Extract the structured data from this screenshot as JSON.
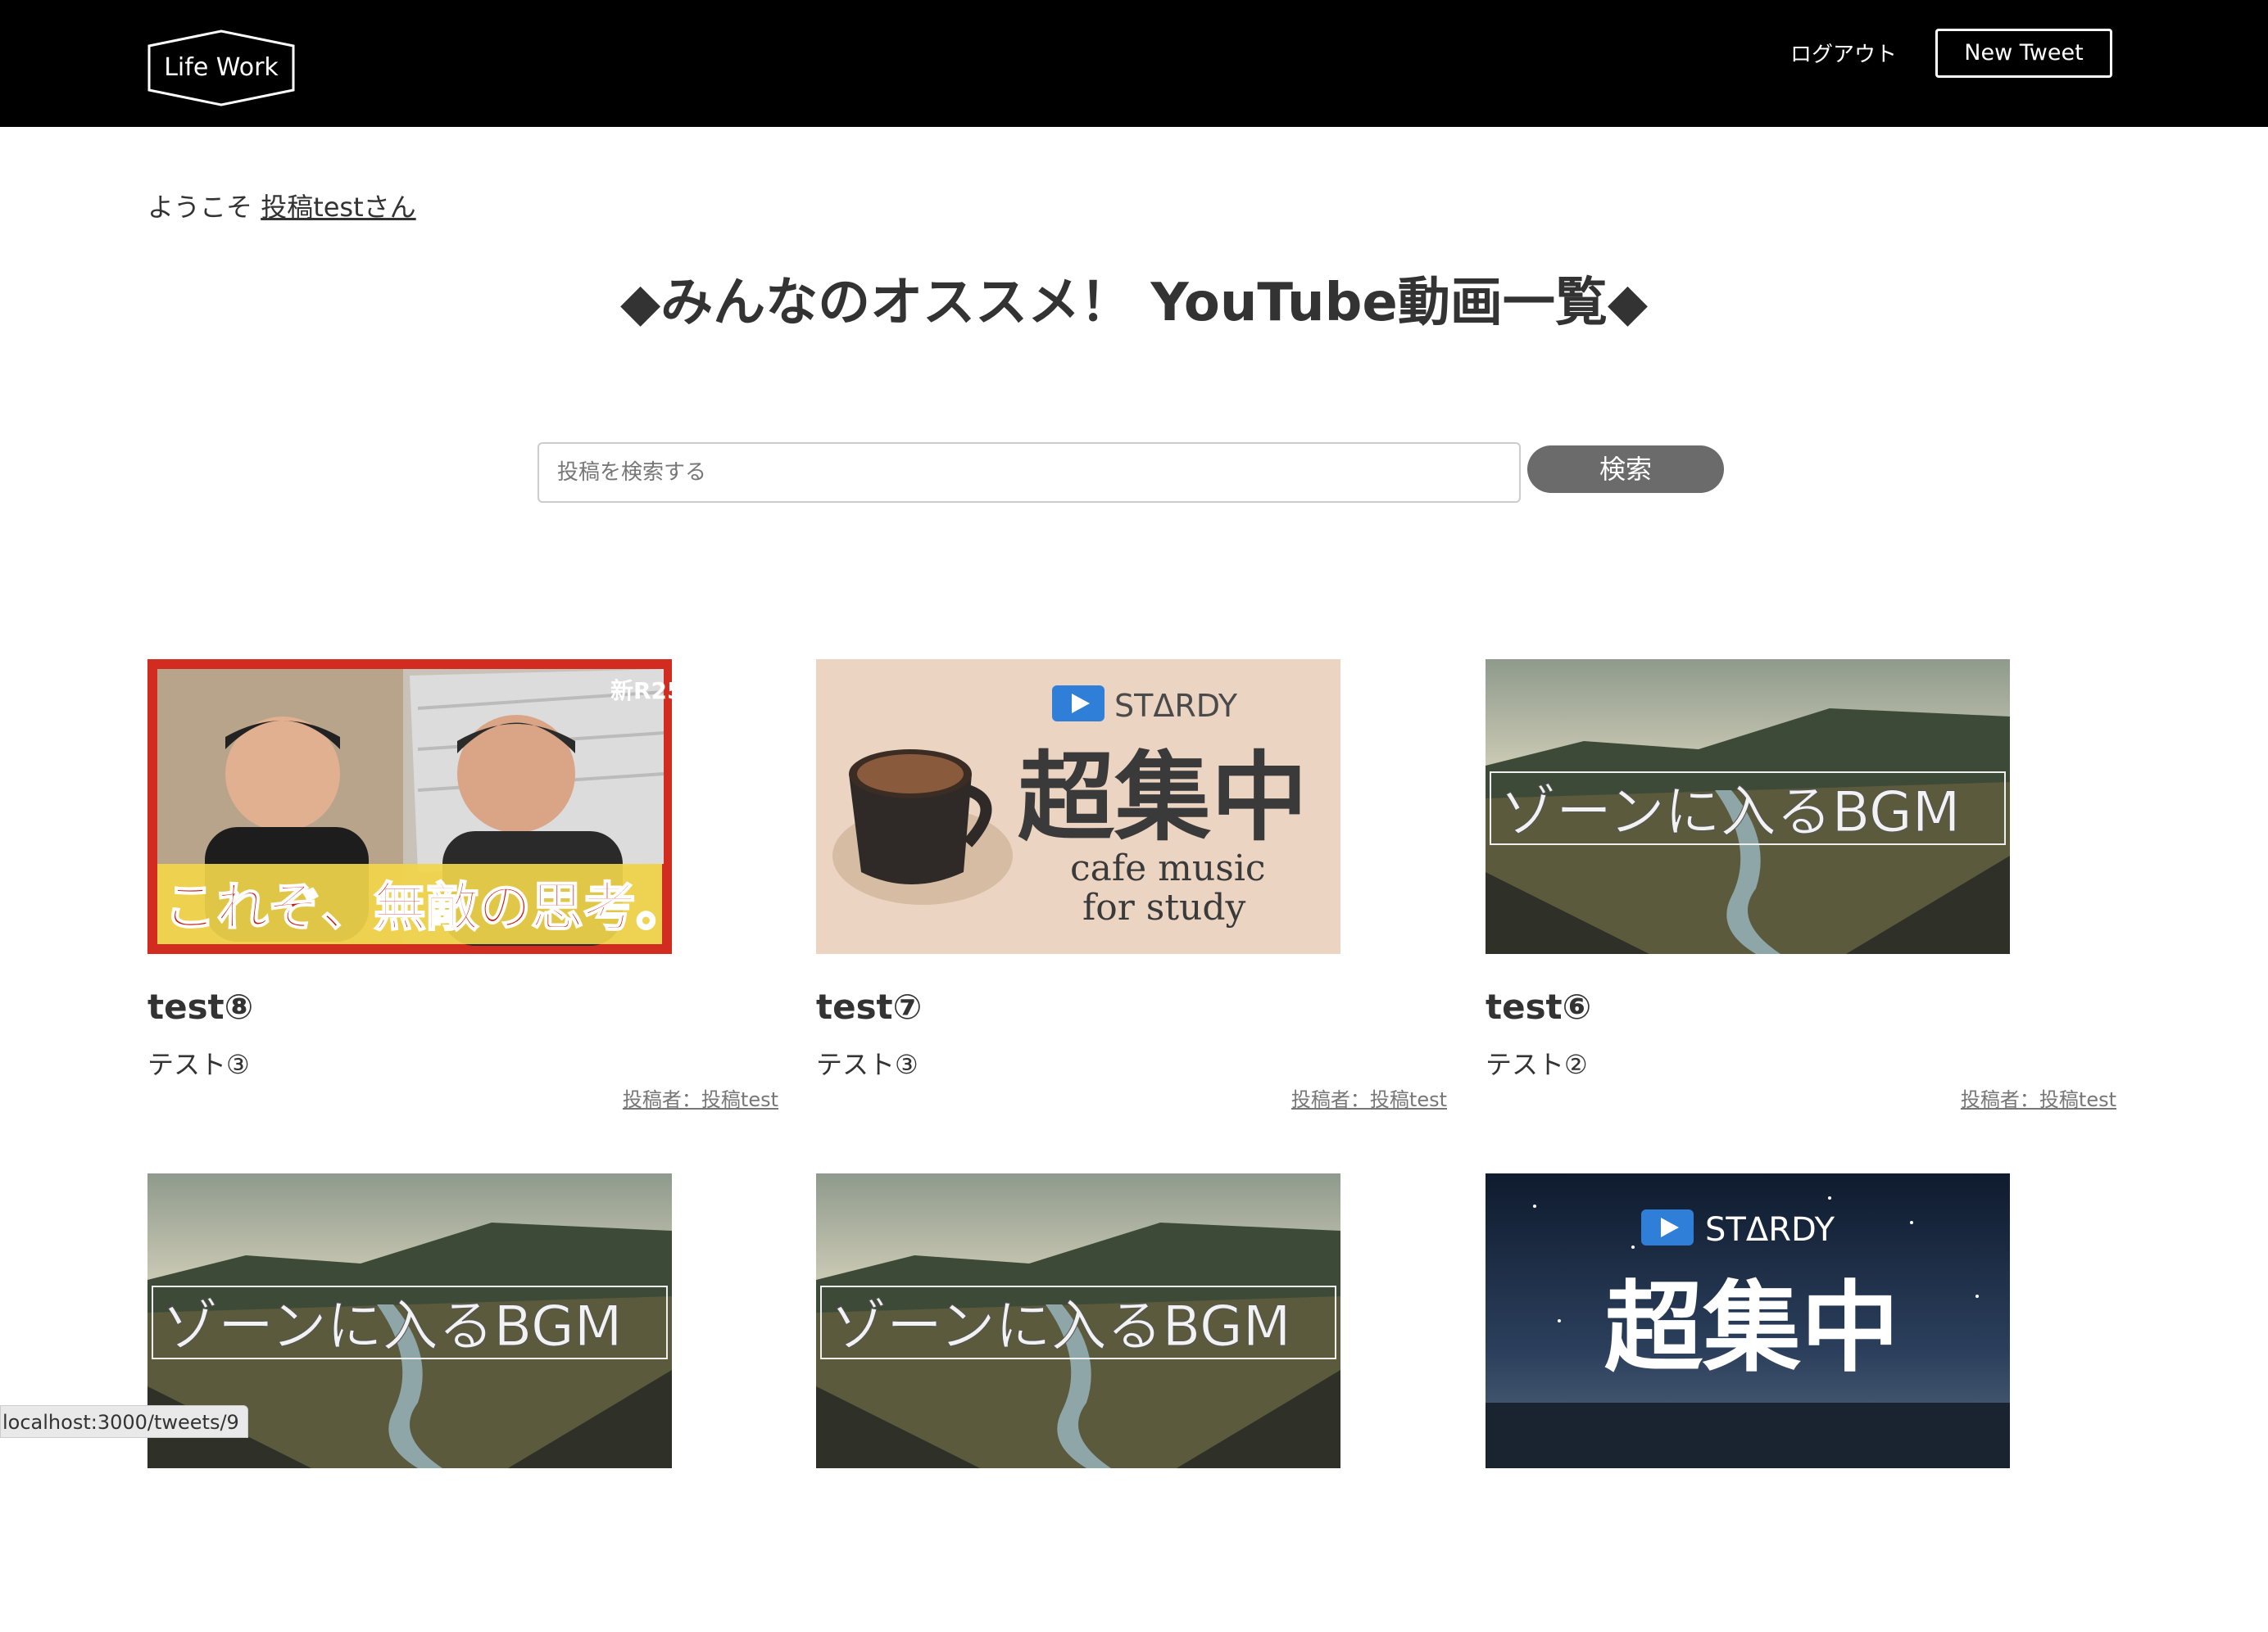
{
  "header": {
    "logo_text": "Life Work",
    "logout_label": "ログアウト",
    "new_tweet_label": "New Tweet"
  },
  "welcome": {
    "prefix": "ようこそ",
    "user_link": "投稿testさん"
  },
  "page_title": "◆みんなのオススメ！ YouTube動画一覧◆",
  "search": {
    "placeholder": "投稿を検索する",
    "button_label": "検索"
  },
  "cards": [
    {
      "title": "test⑧",
      "description": "テスト③",
      "author": "投稿者：投稿test",
      "thumbnail": {
        "kind": "talk-video",
        "badge": "新R25",
        "caption": "これぞ、無敵の思考。"
      }
    },
    {
      "title": "test⑦",
      "description": "テスト③",
      "author": "投稿者：投稿test",
      "thumbnail": {
        "kind": "cafe-music",
        "brand": "STΔRDY",
        "heading": "超集中",
        "sub1": "cafe music",
        "sub2": "for study"
      }
    },
    {
      "title": "test⑥",
      "description": "テスト②",
      "author": "投稿者：投稿test",
      "thumbnail": {
        "kind": "landscape",
        "caption": "ゾーンに入るBGM"
      }
    },
    {
      "thumbnail": {
        "kind": "landscape",
        "caption": "ゾーンに入るBGM"
      }
    },
    {
      "thumbnail": {
        "kind": "landscape",
        "caption": "ゾーンに入るBGM"
      }
    },
    {
      "thumbnail": {
        "kind": "night-sky",
        "brand": "STΔRDY",
        "heading": "超集中"
      }
    }
  ],
  "status_bar": "localhost:3000/tweets/9",
  "colors": {
    "header_bg": "#000000",
    "search_button": "#6b6b6b",
    "accent_red": "#d22b1f"
  }
}
